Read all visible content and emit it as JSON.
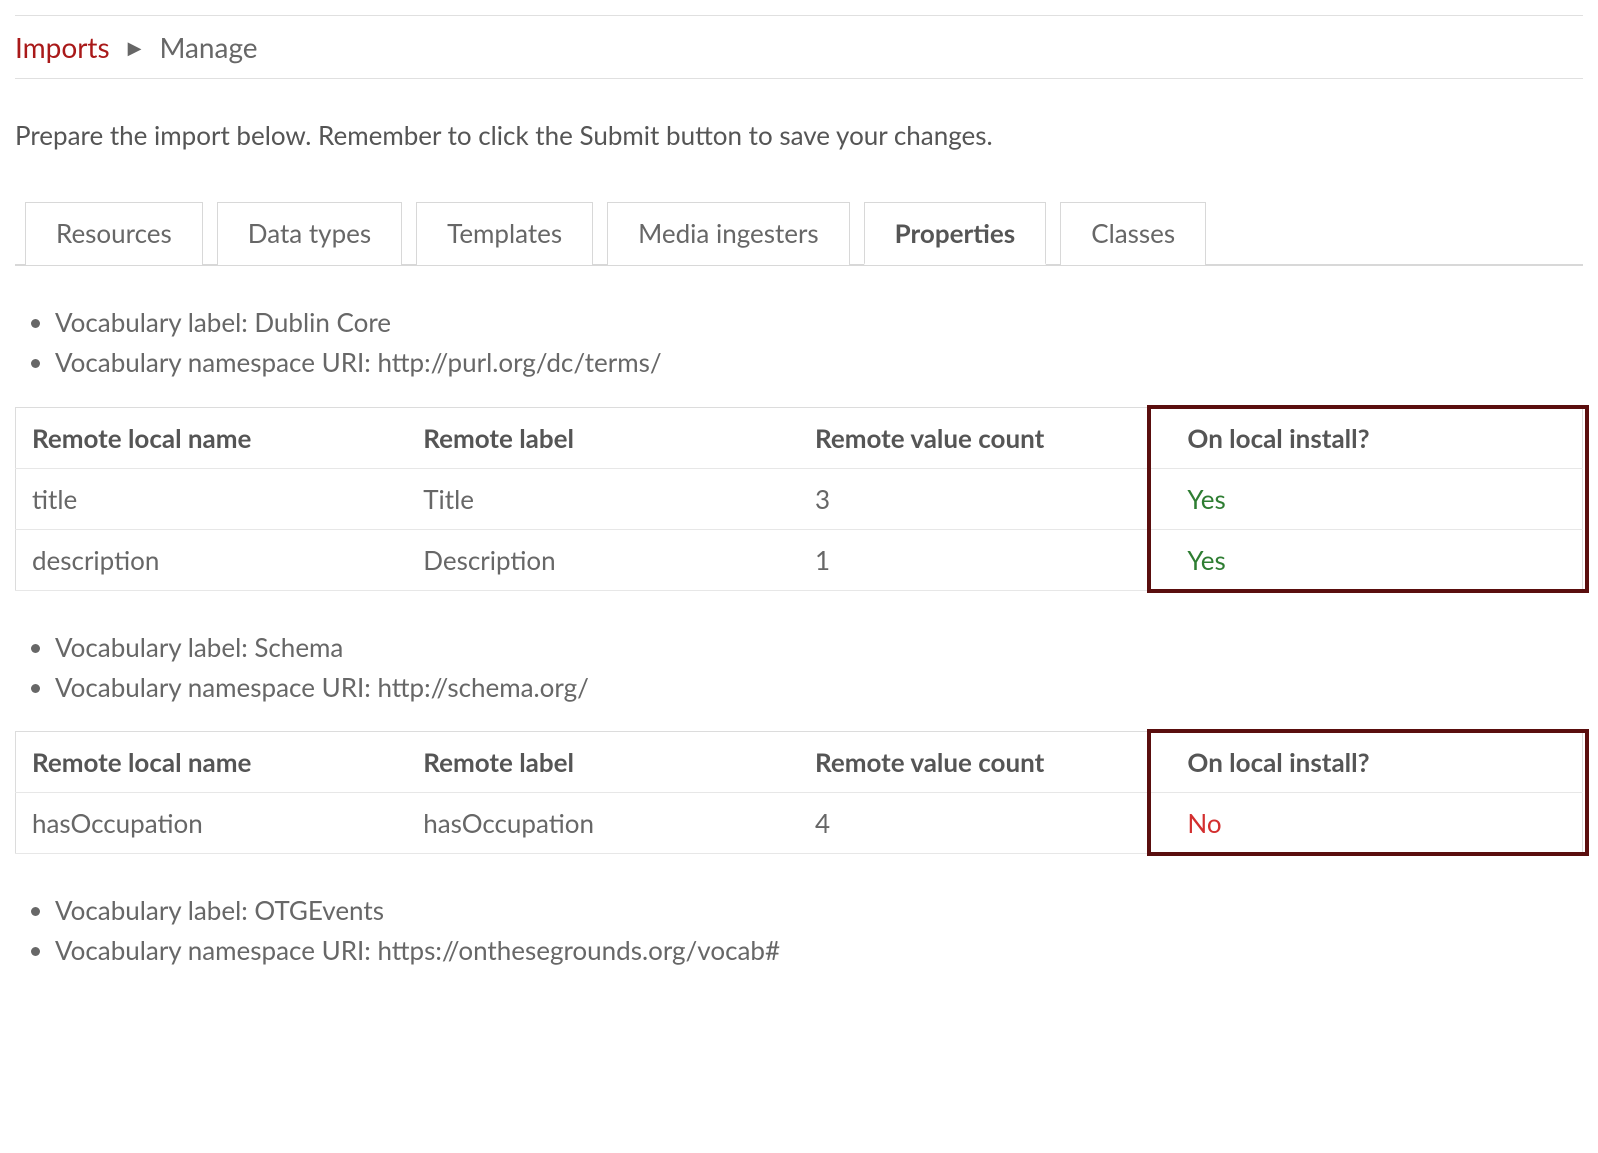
{
  "breadcrumb": {
    "parent": "Imports",
    "current": "Manage"
  },
  "intro": "Prepare the import below. Remember to click the Submit button to save your changes.",
  "tabs": [
    {
      "label": "Resources"
    },
    {
      "label": "Data types"
    },
    {
      "label": "Templates"
    },
    {
      "label": "Media ingesters"
    },
    {
      "label": "Properties",
      "active": true
    },
    {
      "label": "Classes"
    }
  ],
  "labels": {
    "vocab_label_prefix": "Vocabulary label: ",
    "vocab_ns_prefix": "Vocabulary namespace URI: ",
    "col_name": "Remote local name",
    "col_label": "Remote label",
    "col_count": "Remote value count",
    "col_local": "On local install?"
  },
  "sections": [
    {
      "vocab_label": "Dublin Core",
      "vocab_ns": "http://purl.org/dc/terms/",
      "rows": [
        {
          "name": "title",
          "label": "Title",
          "count": "3",
          "local": "Yes",
          "local_class": "yes"
        },
        {
          "name": "description",
          "label": "Description",
          "count": "1",
          "local": "Yes",
          "local_class": "yes"
        }
      ]
    },
    {
      "vocab_label": "Schema",
      "vocab_ns": "http://schema.org/",
      "rows": [
        {
          "name": "hasOccupation",
          "label": "hasOccupation",
          "count": "4",
          "local": "No",
          "local_class": "no"
        }
      ]
    },
    {
      "vocab_label": "OTGEvents",
      "vocab_ns": "https://onthesegrounds.org/vocab#",
      "rows": []
    }
  ]
}
